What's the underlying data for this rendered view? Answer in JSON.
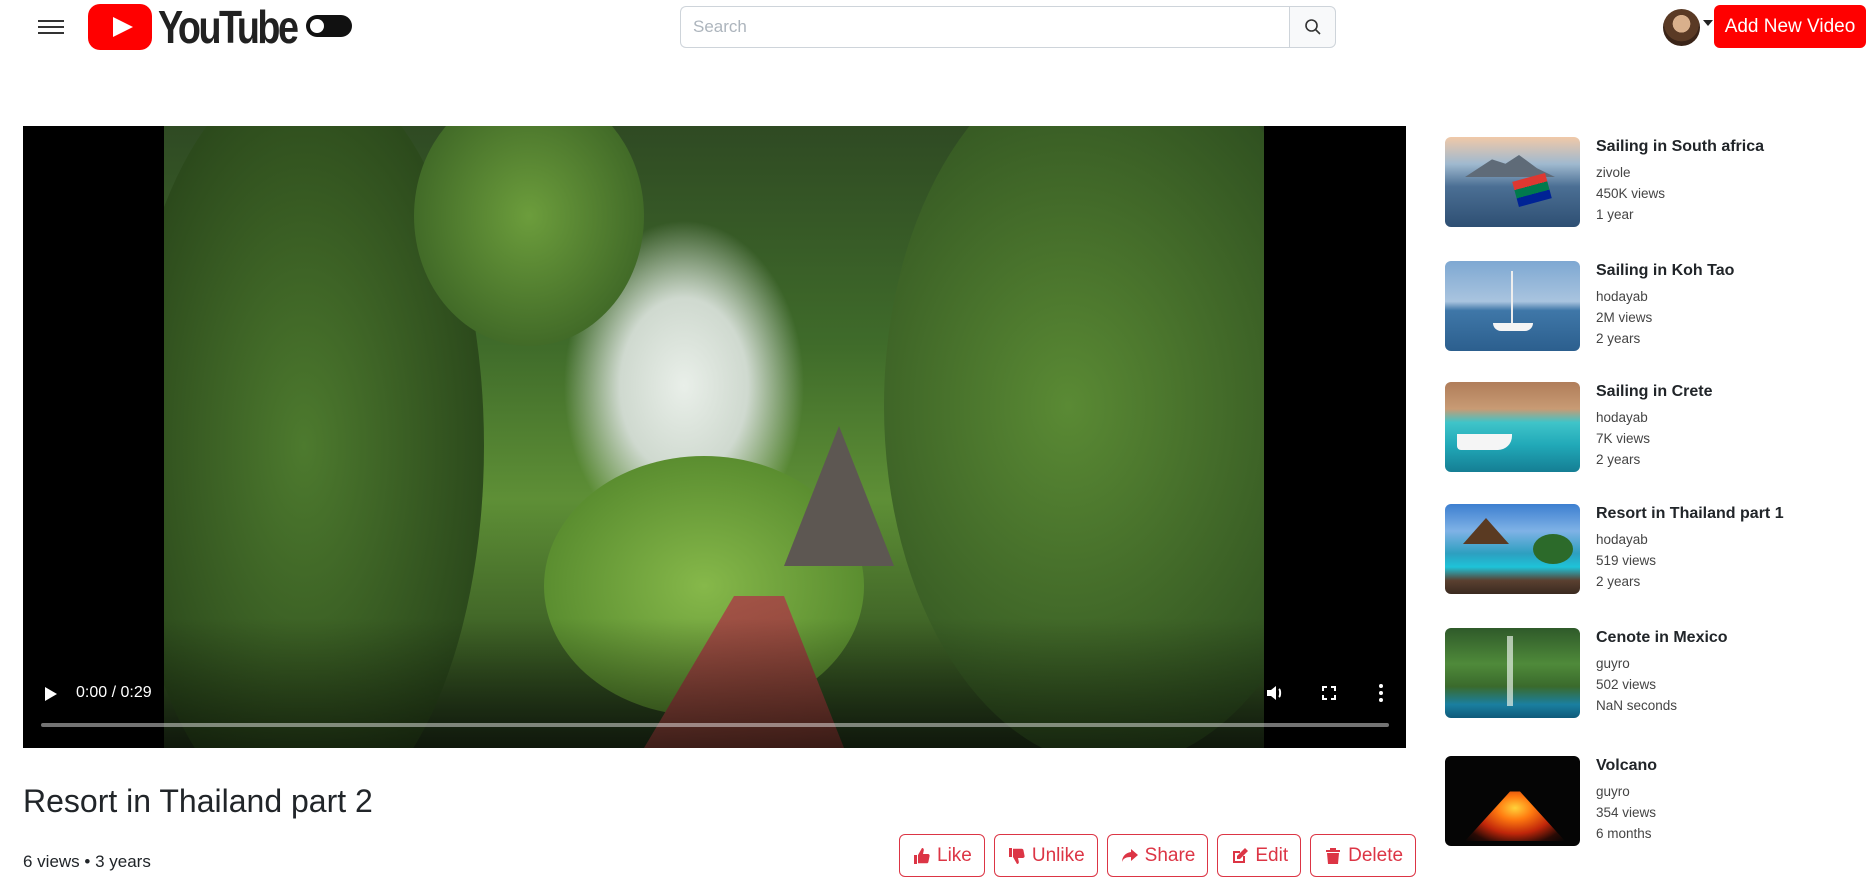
{
  "header": {
    "logo_text": "YouTube",
    "search_placeholder": "Search",
    "add_button_label": "Add New Video"
  },
  "player": {
    "time_display": "0:00 / 0:29",
    "progress": 0
  },
  "video": {
    "title": "Resort in Thailand part 2",
    "meta": "6 views • 3 years"
  },
  "actions": {
    "like": "Like",
    "unlike": "Unlike",
    "share": "Share",
    "edit": "Edit",
    "delete": "Delete"
  },
  "sidebar": {
    "items": [
      {
        "title": "Sailing in South africa",
        "channel": "zivole",
        "views": "450K views",
        "age": "1 year",
        "thumb": "harbor-flag"
      },
      {
        "title": "Sailing in Koh Tao",
        "channel": "hodayab",
        "views": "2M views",
        "age": "2 years",
        "thumb": "sailboat-sea"
      },
      {
        "title": "Sailing in Crete",
        "channel": "hodayab",
        "views": "7K views",
        "age": "2 years",
        "thumb": "boat-turquoise"
      },
      {
        "title": "Resort in Thailand part 1",
        "channel": "hodayab",
        "views": "519 views",
        "age": "2 years",
        "thumb": "resort-pool"
      },
      {
        "title": "Cenote in Mexico",
        "channel": "guyro",
        "views": "502 views",
        "age": "NaN seconds",
        "thumb": "cenote"
      },
      {
        "title": "Volcano",
        "channel": "guyro",
        "views": "354 views",
        "age": "6 months",
        "thumb": "volcano"
      }
    ]
  },
  "colors": {
    "brand_red": "#ff0000",
    "action_red": "#dc3545"
  }
}
